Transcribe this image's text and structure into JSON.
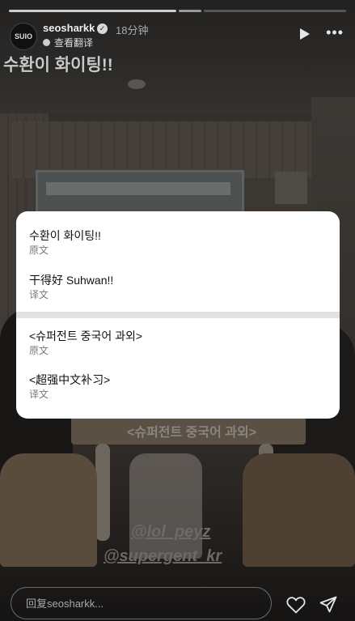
{
  "story": {
    "username": "seosharkk",
    "time_ago": "18分钟",
    "avatar_text": "SUIO",
    "translate_link": "查看翻译",
    "overlay_title": "수환이 화이팅!!",
    "sticker_text": "<슈퍼전트 중국어 과외>",
    "tag_1": "@lol_peyz",
    "tag_2": "@supergent_kr",
    "progress": {
      "segments": 3,
      "current_index": 1
    }
  },
  "popup": {
    "entries": [
      {
        "text": "수환이 화이팅!!",
        "label": "原文"
      },
      {
        "text": "干得好 Suhwan!!",
        "label": "译文"
      },
      {
        "text": "<슈퍼전트 중국어 과외>",
        "label": "原文"
      },
      {
        "text": "<超强中文补习>",
        "label": "译文"
      }
    ]
  },
  "reply": {
    "placeholder": "回复seosharkk..."
  },
  "icons": {
    "verified": "verified-badge-icon",
    "play": "play-icon",
    "more": "more-options-icon",
    "like": "heart-icon",
    "send": "send-icon"
  }
}
